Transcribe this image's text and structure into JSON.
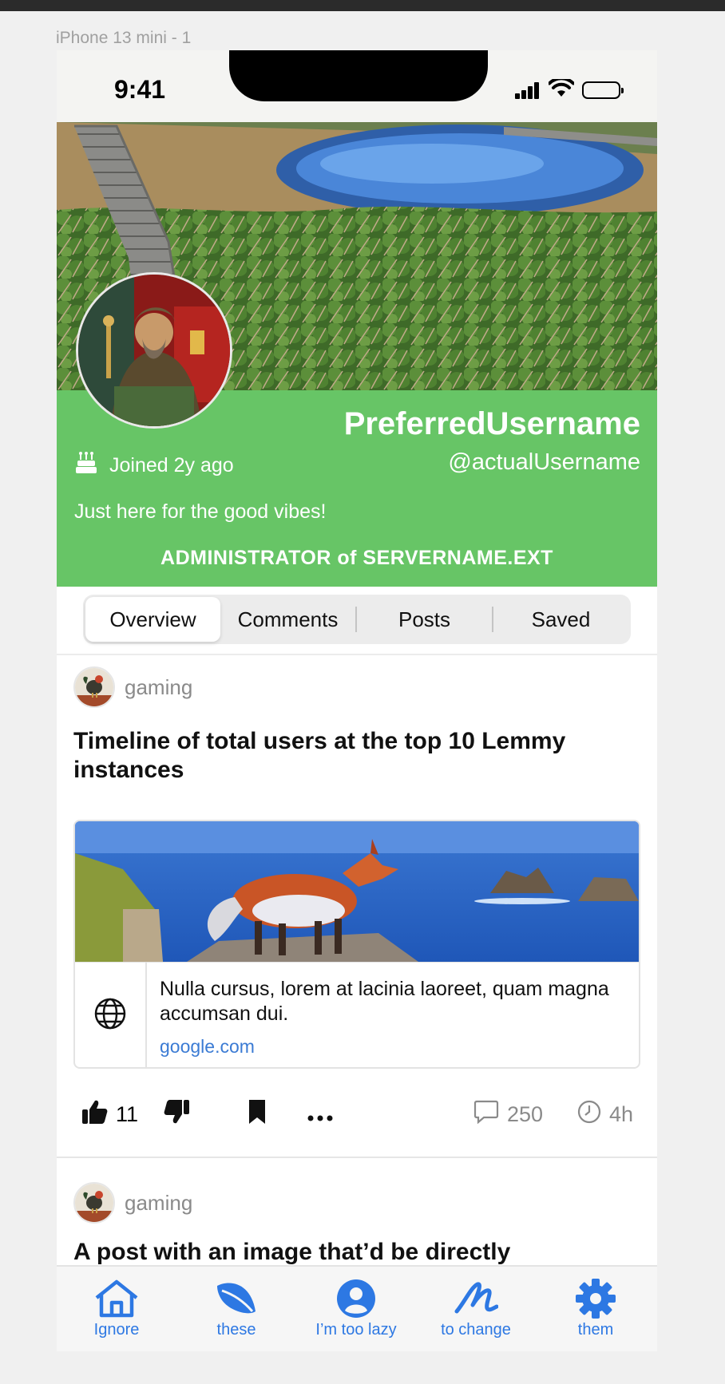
{
  "frame_label": "iPhone 13 mini - 1",
  "status_bar": {
    "time": "9:41"
  },
  "profile": {
    "display_name": "PreferredUsername",
    "handle": "@actualUsername",
    "joined": "Joined 2y ago",
    "bio": "Just here for the good vibes!",
    "role": "ADMINISTRATOR of SERVERNAME.EXT",
    "header_color": "#67c566"
  },
  "tabs": [
    {
      "label": "Overview",
      "selected": true
    },
    {
      "label": "Comments",
      "selected": false
    },
    {
      "label": "Posts",
      "selected": false
    },
    {
      "label": "Saved",
      "selected": false
    }
  ],
  "posts": [
    {
      "community": "gaming",
      "title": "Timeline of total users at the top 10 Lemmy instances",
      "link_text": "Nulla cursus, lorem at lacinia laoreet, quam magna accumsan dui.",
      "link_domain": "google.com",
      "score": "11",
      "comments": "250",
      "age": "4h"
    },
    {
      "community": "gaming",
      "title": "A post with an image that’d be directly"
    }
  ],
  "tab_bar": [
    {
      "label": "Ignore",
      "icon": "house-icon"
    },
    {
      "label": "these",
      "icon": "leaf-icon"
    },
    {
      "label": "I’m too lazy",
      "icon": "person-circle-icon"
    },
    {
      "label": "to change",
      "icon": "scribble-icon"
    },
    {
      "label": "them",
      "icon": "gear-icon"
    }
  ],
  "accent_color": "#2d78e3",
  "link_color": "#3b7bd4"
}
